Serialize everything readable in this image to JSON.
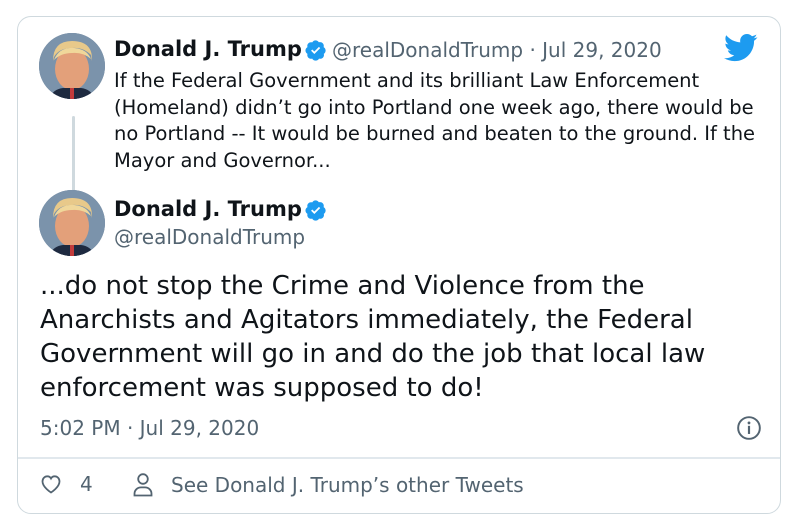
{
  "quoted": {
    "name": "Donald J. Trump",
    "handle": "@realDonaldTrump",
    "separator": "·",
    "date": "Jul 29, 2020",
    "text": "If the Federal Government and its brilliant Law Enforcement (Homeland) didn’t go into Portland one week ago, there would be no Portland -- It would be burned and beaten to the ground. If the Mayor and Governor..."
  },
  "main": {
    "name": "Donald J. Trump",
    "handle": "@realDonaldTrump",
    "text": "...do not stop the Crime and Violence from the Anarchists and Agitators immediately, the Federal Government will go in and do the job that local law enforcement was supposed to do!",
    "timestamp": "5:02 PM · Jul 29, 2020"
  },
  "footer": {
    "like_count": "4",
    "see_more_label": "See Donald J. Trump’s other Tweets"
  },
  "icons": {
    "verified": "verified-badge-icon",
    "logo": "twitter-bird-icon",
    "info": "info-icon",
    "like": "heart-icon",
    "profile": "person-icon"
  },
  "colors": {
    "brand_blue": "#1d9bf0",
    "text_primary": "#0f1419",
    "text_secondary": "#536471",
    "border": "#cfd9de"
  }
}
